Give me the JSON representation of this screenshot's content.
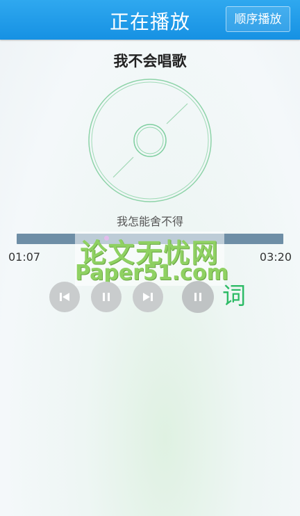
{
  "header": {
    "title": "正在播放",
    "mode_button": "顺序播放"
  },
  "song": {
    "title": "我不会唱歌",
    "lyric_line": "我怎能舍不得"
  },
  "progress": {
    "current": "01:07",
    "total": "03:20",
    "fraction": 0.335
  },
  "controls": {
    "prev_icon": "skip-previous-icon",
    "pause_icon": "pause-icon",
    "next_icon": "skip-next-icon",
    "pause2_icon": "pause-icon",
    "lyrics_label": "词"
  },
  "watermark": {
    "line1": "论文无忧网",
    "line2": "Paper51.com"
  },
  "colors": {
    "header": "#1a96e6",
    "accent_green": "#2dbb66",
    "disc": "#7fcfa0",
    "progress": "#6e8ea6"
  }
}
